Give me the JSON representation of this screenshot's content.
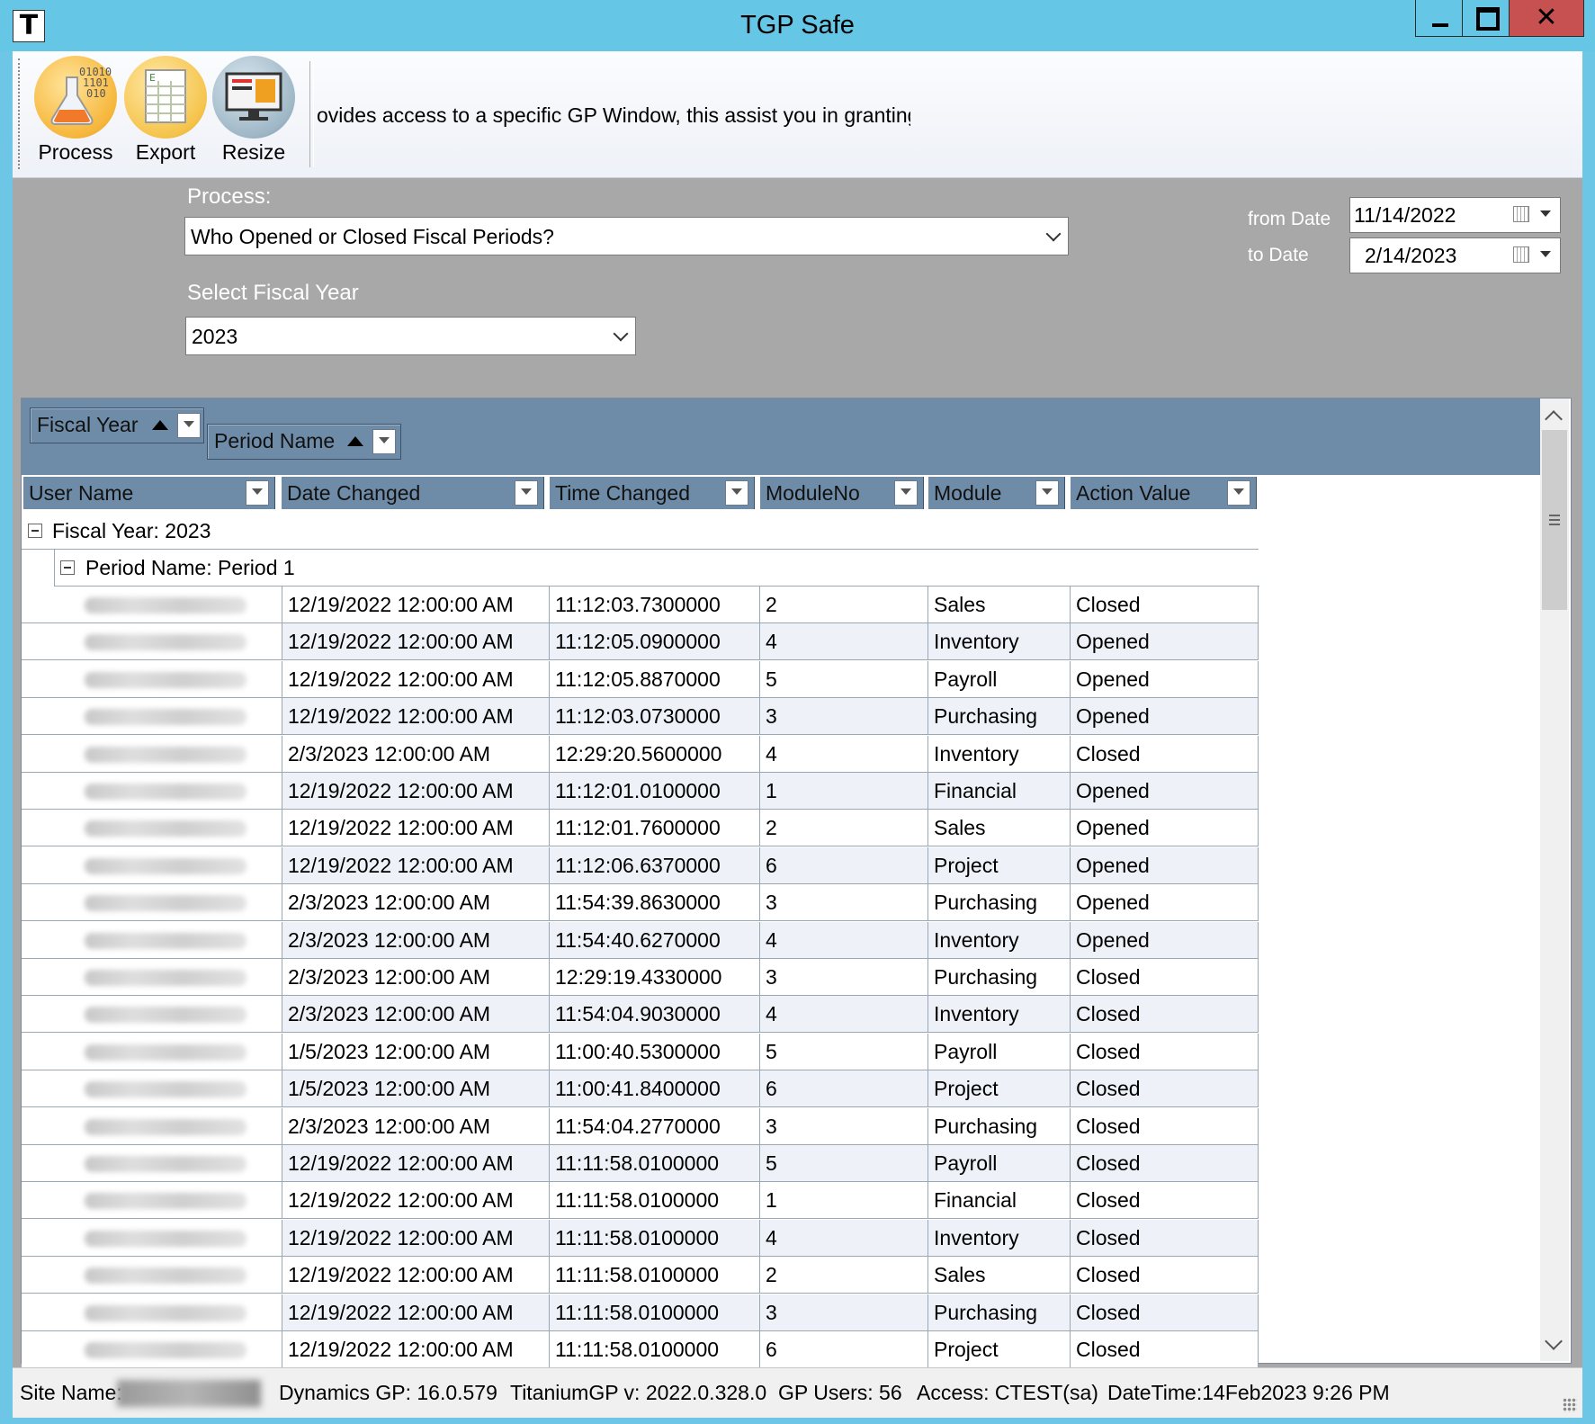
{
  "window": {
    "app_icon_letter": "T",
    "title": "TGP Safe"
  },
  "toolbar": {
    "buttons": [
      {
        "label": "Process",
        "icon": "process-flask-icon"
      },
      {
        "label": "Export",
        "icon": "export-spreadsheet-icon"
      },
      {
        "label": "Resize",
        "icon": "resize-monitor-icon"
      }
    ],
    "marquee_text": "ovides access to a specific GP Window, this assist you in granting tl"
  },
  "filters": {
    "process_label": "Process:",
    "process_value": "Who Opened or Closed Fiscal Periods?",
    "fiscal_year_label": "Select Fiscal Year",
    "fiscal_year_value": "2023",
    "from_date_label": "from Date",
    "from_date_value": "11/14/2022",
    "to_date_label": "to Date",
    "to_date_value": "2/14/2023"
  },
  "grid": {
    "group_by": [
      {
        "label": "Fiscal Year"
      },
      {
        "label": "Period Name"
      }
    ],
    "columns": [
      "User Name",
      "Date Changed",
      "Time Changed",
      "ModuleNo",
      "Module",
      "Action Value"
    ],
    "group_row_1": "Fiscal Year: 2023",
    "group_row_2": "Period Name: Period 1",
    "rows": [
      [
        "12/19/2022 12:00:00 AM",
        "11:12:03.7300000",
        "2",
        "Sales",
        "Closed"
      ],
      [
        "12/19/2022 12:00:00 AM",
        "11:12:05.0900000",
        "4",
        "Inventory",
        "Opened"
      ],
      [
        "12/19/2022 12:00:00 AM",
        "11:12:05.8870000",
        "5",
        "Payroll",
        "Opened"
      ],
      [
        "12/19/2022 12:00:00 AM",
        "11:12:03.0730000",
        "3",
        "Purchasing",
        "Opened"
      ],
      [
        "2/3/2023 12:00:00 AM",
        "12:29:20.5600000",
        "4",
        "Inventory",
        "Closed"
      ],
      [
        "12/19/2022 12:00:00 AM",
        "11:12:01.0100000",
        "1",
        "Financial",
        "Opened"
      ],
      [
        "12/19/2022 12:00:00 AM",
        "11:12:01.7600000",
        "2",
        "Sales",
        "Opened"
      ],
      [
        "12/19/2022 12:00:00 AM",
        "11:12:06.6370000",
        "6",
        "Project",
        "Opened"
      ],
      [
        "2/3/2023 12:00:00 AM",
        "11:54:39.8630000",
        "3",
        "Purchasing",
        "Opened"
      ],
      [
        "2/3/2023 12:00:00 AM",
        "11:54:40.6270000",
        "4",
        "Inventory",
        "Opened"
      ],
      [
        "2/3/2023 12:00:00 AM",
        "12:29:19.4330000",
        "3",
        "Purchasing",
        "Closed"
      ],
      [
        "2/3/2023 12:00:00 AM",
        "11:54:04.9030000",
        "4",
        "Inventory",
        "Closed"
      ],
      [
        "1/5/2023 12:00:00 AM",
        "11:00:40.5300000",
        "5",
        "Payroll",
        "Closed"
      ],
      [
        "1/5/2023 12:00:00 AM",
        "11:00:41.8400000",
        "6",
        "Project",
        "Closed"
      ],
      [
        "2/3/2023 12:00:00 AM",
        "11:54:04.2770000",
        "3",
        "Purchasing",
        "Closed"
      ],
      [
        "12/19/2022 12:00:00 AM",
        "11:11:58.0100000",
        "5",
        "Payroll",
        "Closed"
      ],
      [
        "12/19/2022 12:00:00 AM",
        "11:11:58.0100000",
        "1",
        "Financial",
        "Closed"
      ],
      [
        "12/19/2022 12:00:00 AM",
        "11:11:58.0100000",
        "4",
        "Inventory",
        "Closed"
      ],
      [
        "12/19/2022 12:00:00 AM",
        "11:11:58.0100000",
        "2",
        "Sales",
        "Closed"
      ],
      [
        "12/19/2022 12:00:00 AM",
        "11:11:58.0100000",
        "3",
        "Purchasing",
        "Closed"
      ],
      [
        "12/19/2022 12:00:00 AM",
        "11:11:58.0100000",
        "6",
        "Project",
        "Closed"
      ]
    ]
  },
  "status": {
    "site_name_label": "Site Name:",
    "dynamics_gp": "Dynamics GP: 16.0.579",
    "titanium": "TitaniumGP v: 2022.0.328.0",
    "gp_users": "GP Users: 56",
    "access": "Access: CTEST(sa)",
    "datetime": "DateTime:14Feb2023 9:26 PM"
  },
  "colors": {
    "titlebar": "#66c6e6",
    "close": "#c75050",
    "grid_header": "#6e8ca8",
    "panel": "#a8a8a8"
  }
}
